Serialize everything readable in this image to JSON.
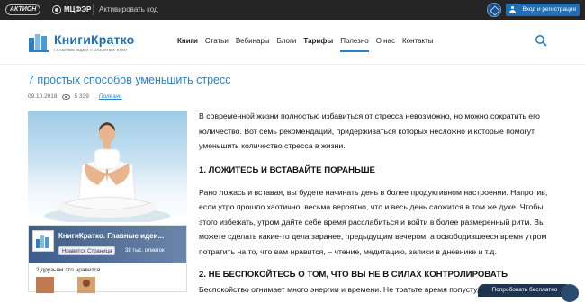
{
  "topbar": {
    "aktion": "АКТИОН",
    "mcfer": "МЦФЭР",
    "activate_code": "Активировать код",
    "login_button": "Вход и регистрация"
  },
  "header": {
    "logo_title": "КнигиКратко",
    "logo_subtitle": "ГЛАВНЫЕ ИДЕИ ПОЛЕЗНЫХ КНИГ",
    "nav": [
      "Книги",
      "Статьи",
      "Вебинары",
      "Блоги",
      "Тарифы",
      "Полезно",
      "О нас",
      "Контакты"
    ],
    "active_nav": "Полезно"
  },
  "article": {
    "title": "7 простых способов уменьшить стресс",
    "date": "09.10.2018",
    "views": "5 339",
    "category": "Полезно",
    "intro": "В современной жизни полностью избавиться от стресса невозможно, но можно сократить его количество. Вот семь рекомендаций, придерживаться которых несложно и которые помогут уменьшить количество стресса в жизни.",
    "h1": "1. ЛОЖИТЕСЬ И ВСТАВАЙТЕ ПОРАНЬШЕ",
    "p1": "Рано ложась и вставая, вы будете начинать день в более продуктивном настроении. Напротив, если утро прошло хаотично, весьма вероятно, что и весь день сложится в том же духе. Чтобы этого избежать, утром дайте себе время расслабиться и войти в более размеренный ритм. Вы можете сделать какие-то дела заранее, предыдущим вечером, а освободившееся время утром потратить на то, что вам нравится, – чтение, медитацию, записи в дневнике и т.д.",
    "h2": "2. НЕ БЕСПОКОЙТЕСЬ О ТОМ, ЧТО ВЫ НЕ В СИЛАХ КОНТРОЛИРОВАТЬ",
    "p2": "Беспокойство отнимает много энергии и времени. Не тратьте время попусту, беспокоясь о"
  },
  "facebook": {
    "page_name": "КнигиКратко. Главные идеи...",
    "like_button": "Нравится Страница",
    "likes": "38 тыс. отметок",
    "friends": "2 друзьям это нравится"
  },
  "promo": {
    "label": "Попробовать бесплатно"
  }
}
